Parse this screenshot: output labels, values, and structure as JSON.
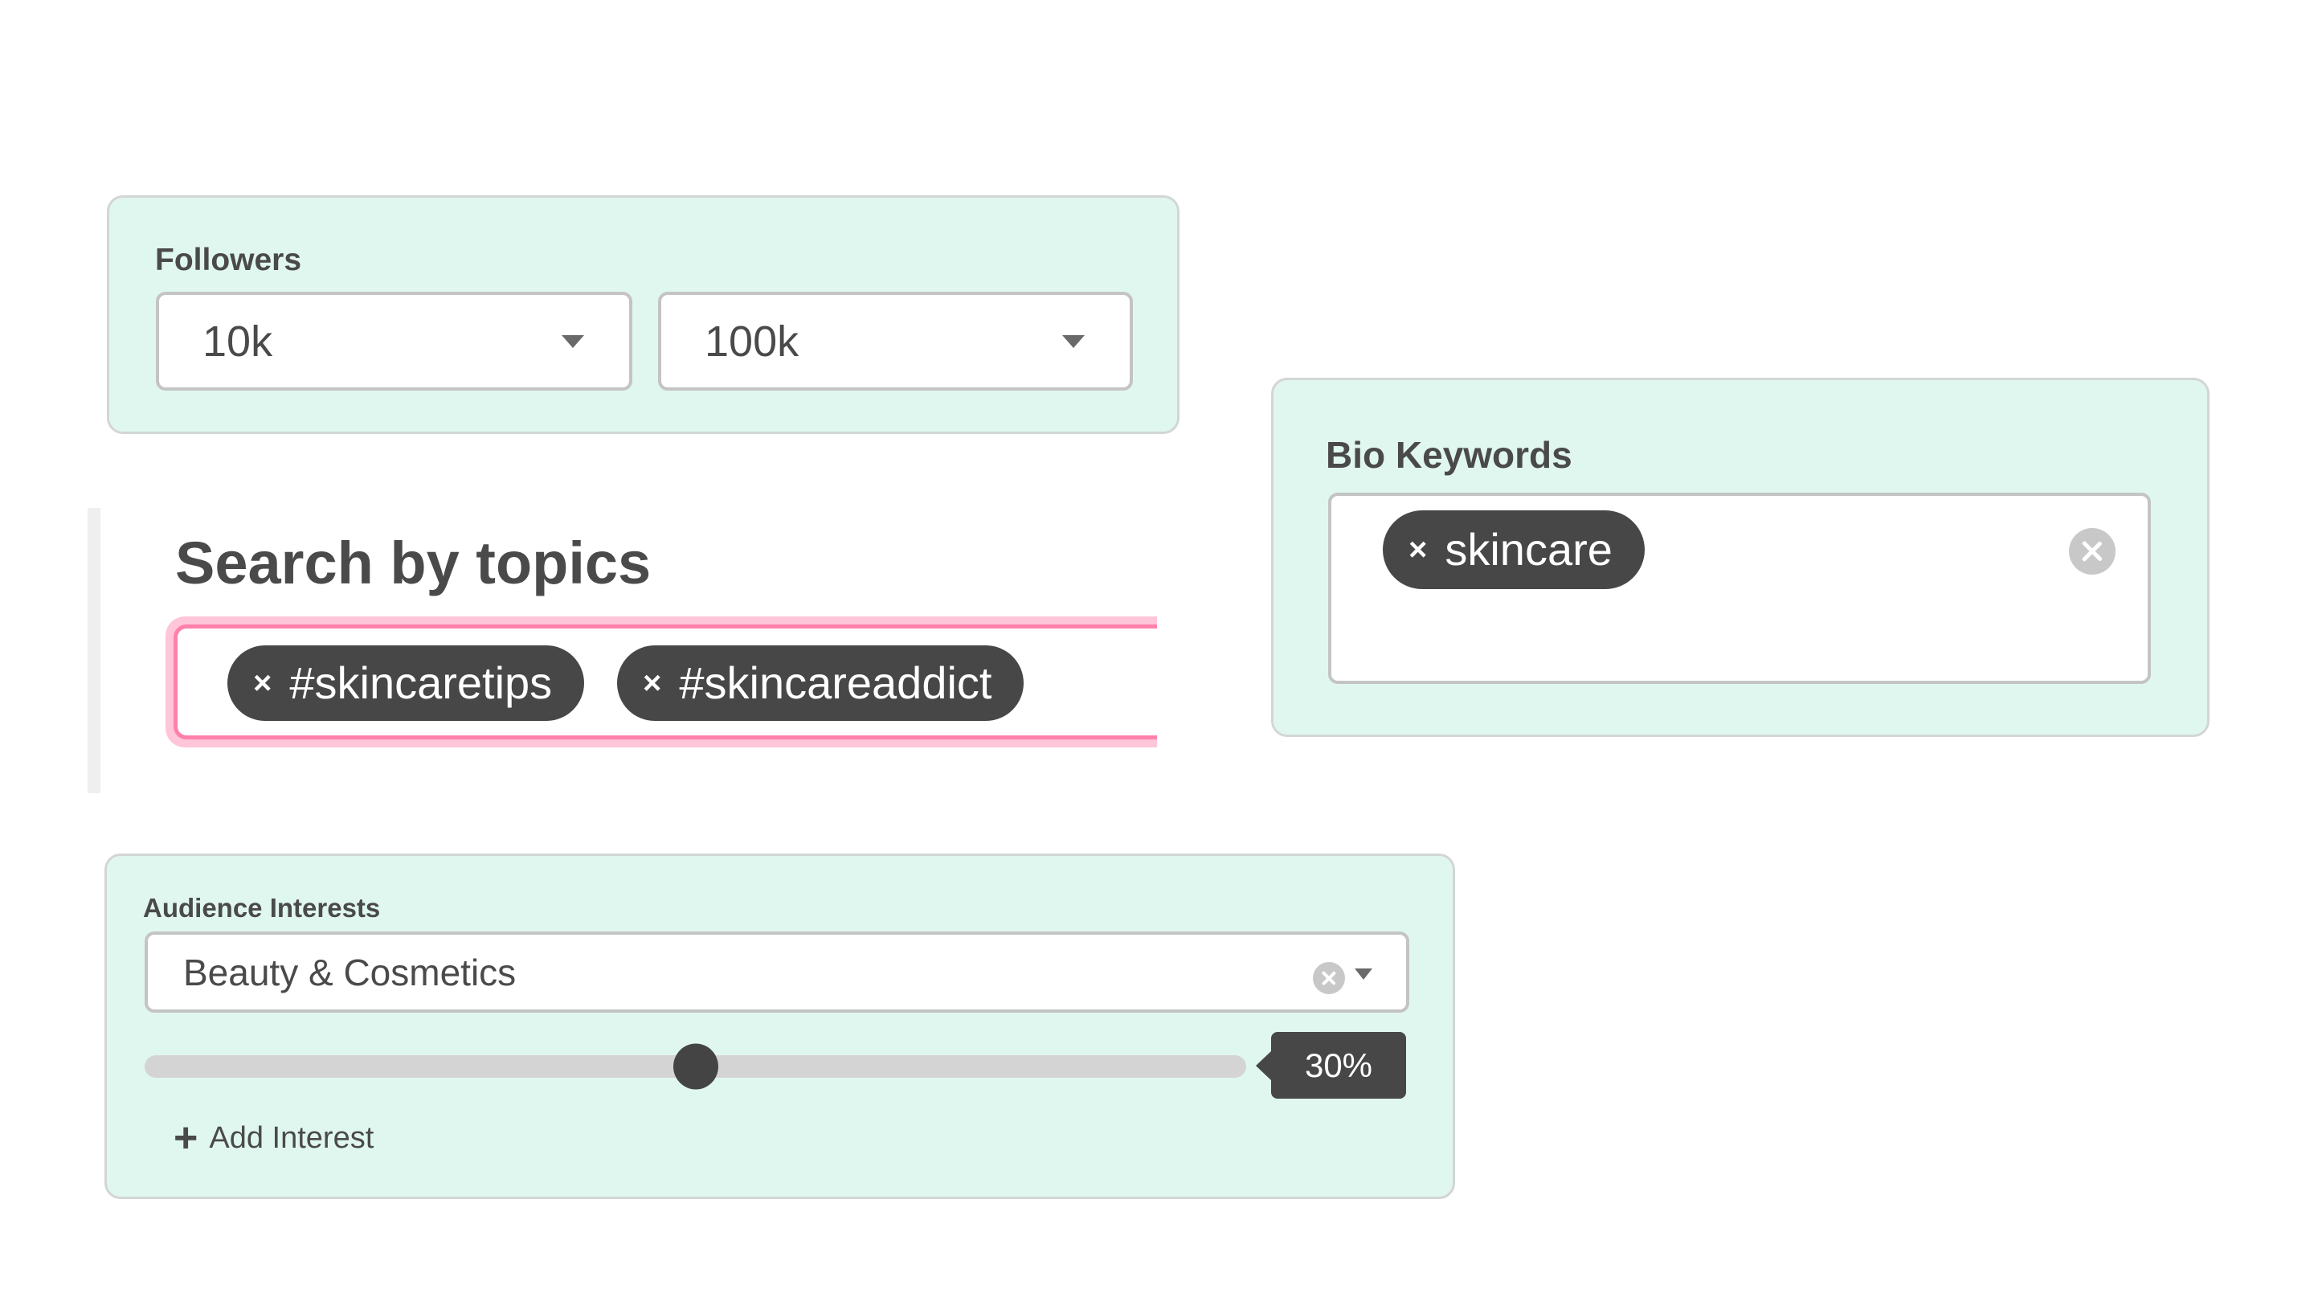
{
  "followers": {
    "label": "Followers",
    "min": {
      "value": "10k",
      "icon": "caret-down-icon"
    },
    "max": {
      "value": "100k",
      "icon": "caret-down-icon"
    }
  },
  "topics": {
    "heading": "Search by topics",
    "tags": [
      {
        "remove_icon": "×",
        "label": "#skincaretips"
      },
      {
        "remove_icon": "×",
        "label": "#skincareaddict"
      }
    ]
  },
  "bio": {
    "label": "Bio Keywords",
    "tags": [
      {
        "remove_icon": "×",
        "label": "skincare"
      }
    ],
    "clear_icon": "clear-circle-icon"
  },
  "audience": {
    "label": "Audience Interests",
    "selected": "Beauty & Cosmetics",
    "clear_icon": "clear-circle-icon",
    "dropdown_icon": "caret-down-icon",
    "slider": {
      "value_label": "30%",
      "thumb_position": 0.5
    },
    "add_button": {
      "icon": "+",
      "label": "Add Interest"
    }
  },
  "colors": {
    "panel_bg": "#e0f7f0",
    "chip_bg": "#474747",
    "focus_ring": "#ffc5d8",
    "focus_border": "#ff80ab",
    "text": "#4a4a4a"
  }
}
